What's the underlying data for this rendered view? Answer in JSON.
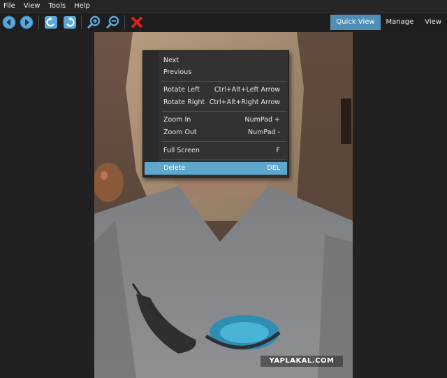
{
  "menubar": {
    "items": [
      "File",
      "View",
      "Tools",
      "Help"
    ]
  },
  "toolbar": {
    "buttons": [
      "back-icon",
      "forward-icon",
      "rotate-left-icon",
      "rotate-right-icon",
      "zoom-in-icon",
      "zoom-out-icon",
      "delete-icon"
    ]
  },
  "tabs": {
    "items": [
      "Quick View",
      "Manage",
      "View"
    ],
    "active": "Quick View"
  },
  "photo": {
    "watermark": "YAPLAKAL.COM"
  },
  "context_menu": {
    "items": [
      {
        "label": "Next",
        "shortcut": ""
      },
      {
        "label": "Previous",
        "shortcut": ""
      },
      {
        "label": "Rotate Left",
        "shortcut": "Ctrl+Alt+Left Arrow"
      },
      {
        "label": "Rotate Right",
        "shortcut": "Ctrl+Alt+Right Arrow"
      },
      {
        "label": "Zoom In",
        "shortcut": "NumPad +"
      },
      {
        "label": "Zoom Out",
        "shortcut": "NumPad -"
      },
      {
        "label": "Full Screen",
        "shortcut": "F"
      },
      {
        "label": "Delete",
        "shortcut": "DEL"
      }
    ],
    "highlighted": "Delete"
  },
  "colors": {
    "accent": "#4e8fb5",
    "highlight": "#5fa6cc",
    "delete": "#e02020"
  }
}
